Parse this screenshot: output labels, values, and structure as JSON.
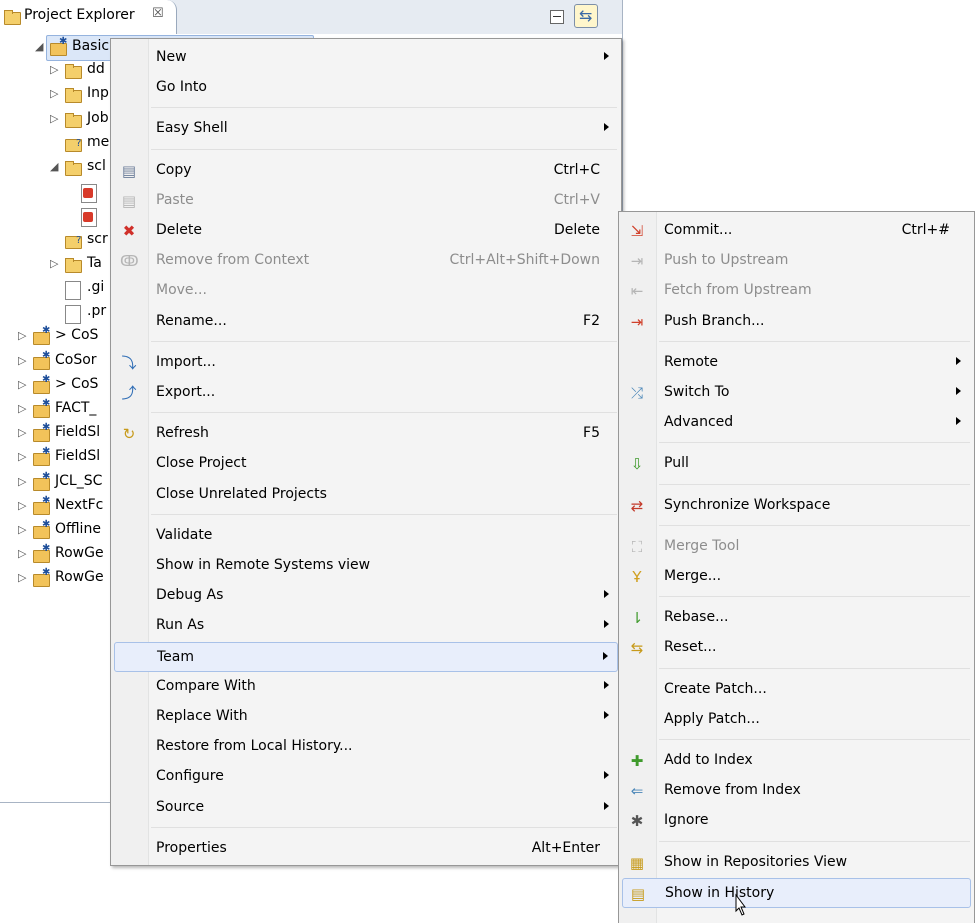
{
  "explorer": {
    "tab_title": "Project Explorer",
    "tab_close": "☒",
    "link_icon": "⇆",
    "tree": [
      {
        "label": "Basic P",
        "twisty": "◢",
        "icon": "project",
        "indent": 1,
        "selected": true
      },
      {
        "label": "dd",
        "twisty": "▷",
        "icon": "folder",
        "indent": 2
      },
      {
        "label": "Inp",
        "twisty": "▷",
        "icon": "folder",
        "indent": 2
      },
      {
        "label": "Job",
        "twisty": "▷",
        "icon": "folder",
        "indent": 2
      },
      {
        "label": "me",
        "twisty": "",
        "icon": "folder-q",
        "indent": 2
      },
      {
        "label": "scl",
        "twisty": "◢",
        "icon": "folder",
        "indent": 2
      },
      {
        "label": "",
        "twisty": "",
        "icon": "file-red",
        "indent": 3
      },
      {
        "label": "",
        "twisty": "",
        "icon": "file-red",
        "indent": 3
      },
      {
        "label": "scr",
        "twisty": "",
        "icon": "folder-q",
        "indent": 2
      },
      {
        "label": "Ta",
        "twisty": "▷",
        "icon": "folder",
        "indent": 2
      },
      {
        "label": ".gi",
        "twisty": "",
        "icon": "file",
        "indent": 2
      },
      {
        "label": ".pr",
        "twisty": "",
        "icon": "file-x",
        "indent": 2
      },
      {
        "label": "> CoS",
        "twisty": "▷",
        "icon": "project",
        "indent": 0
      },
      {
        "label": "CoSor",
        "twisty": "▷",
        "icon": "project",
        "indent": 0
      },
      {
        "label": "> CoS",
        "twisty": "▷",
        "icon": "project",
        "indent": 0
      },
      {
        "label": "FACT_",
        "twisty": "▷",
        "icon": "project",
        "indent": 0
      },
      {
        "label": "FieldSl",
        "twisty": "▷",
        "icon": "project",
        "indent": 0
      },
      {
        "label": "FieldSl",
        "twisty": "▷",
        "icon": "project",
        "indent": 0
      },
      {
        "label": "JCL_SC",
        "twisty": "▷",
        "icon": "project",
        "indent": 0
      },
      {
        "label": "NextFc",
        "twisty": "▷",
        "icon": "project",
        "indent": 0
      },
      {
        "label": "Offline",
        "twisty": "▷",
        "icon": "project",
        "indent": 0
      },
      {
        "label": "RowGe",
        "twisty": "▷",
        "icon": "project",
        "indent": 0
      },
      {
        "label": "RowGe",
        "twisty": "▷",
        "icon": "project",
        "indent": 0
      }
    ]
  },
  "context_menu": {
    "items": [
      {
        "type": "item",
        "label": "New",
        "submenu": true
      },
      {
        "type": "item",
        "label": "Go Into"
      },
      {
        "type": "sep"
      },
      {
        "type": "item",
        "label": "Easy Shell",
        "submenu": true
      },
      {
        "type": "sep"
      },
      {
        "type": "item",
        "label": "Copy",
        "shortcut": "Ctrl+C",
        "icon": "copy-icon",
        "glyph": "▤",
        "color": "#6b7d99"
      },
      {
        "type": "item",
        "label": "Paste",
        "shortcut": "Ctrl+V",
        "icon": "paste-icon",
        "glyph": "▤",
        "color": "#b5b5b5",
        "disabled": true
      },
      {
        "type": "item",
        "label": "Delete",
        "shortcut": "Delete",
        "icon": "delete-icon",
        "glyph": "✖",
        "color": "#d0302a"
      },
      {
        "type": "item",
        "label": "Remove from Context",
        "shortcut": "Ctrl+Alt+Shift+Down",
        "icon": "remove-context-icon",
        "glyph": "ↂ",
        "color": "#b5b5b5",
        "disabled": true
      },
      {
        "type": "item",
        "label": "Move...",
        "disabled": true
      },
      {
        "type": "item",
        "label": "Rename...",
        "shortcut": "F2"
      },
      {
        "type": "sep"
      },
      {
        "type": "item",
        "label": "Import...",
        "icon": "import-icon",
        "glyph": "⤵",
        "color": "#2f6db5"
      },
      {
        "type": "item",
        "label": "Export...",
        "icon": "export-icon",
        "glyph": "⤴",
        "color": "#2f6db5"
      },
      {
        "type": "sep"
      },
      {
        "type": "item",
        "label": "Refresh",
        "shortcut": "F5",
        "icon": "refresh-icon",
        "glyph": "↻",
        "color": "#c79a1a"
      },
      {
        "type": "item",
        "label": "Close Project"
      },
      {
        "type": "item",
        "label": "Close Unrelated Projects"
      },
      {
        "type": "sep"
      },
      {
        "type": "item",
        "label": "Validate"
      },
      {
        "type": "item",
        "label": "Show in Remote Systems view"
      },
      {
        "type": "item",
        "label": "Debug As",
        "submenu": true
      },
      {
        "type": "item",
        "label": "Run As",
        "submenu": true
      },
      {
        "type": "item",
        "label": "Team",
        "submenu": true,
        "highlight": true
      },
      {
        "type": "item",
        "label": "Compare With",
        "submenu": true
      },
      {
        "type": "item",
        "label": "Replace With",
        "submenu": true
      },
      {
        "type": "item",
        "label": "Restore from Local History..."
      },
      {
        "type": "item",
        "label": "Configure",
        "submenu": true
      },
      {
        "type": "item",
        "label": "Source",
        "submenu": true
      },
      {
        "type": "sep"
      },
      {
        "type": "item",
        "label": "Properties",
        "shortcut": "Alt+Enter"
      }
    ]
  },
  "team_menu": {
    "items": [
      {
        "type": "item",
        "label": "Commit...",
        "shortcut": "Ctrl+#",
        "icon": "commit-icon",
        "glyph": "⇲",
        "color": "#d0402a"
      },
      {
        "type": "item",
        "label": "Push to Upstream",
        "icon": "push-upstream-icon",
        "glyph": "⇥",
        "color": "#b5b5b5",
        "disabled": true
      },
      {
        "type": "item",
        "label": "Fetch from Upstream",
        "icon": "fetch-upstream-icon",
        "glyph": "⇤",
        "color": "#b5b5b5",
        "disabled": true
      },
      {
        "type": "item",
        "label": "Push Branch...",
        "icon": "push-branch-icon",
        "glyph": "⇥",
        "color": "#d0402a"
      },
      {
        "type": "sep"
      },
      {
        "type": "item",
        "label": "Remote",
        "submenu": true
      },
      {
        "type": "item",
        "label": "Switch To",
        "submenu": true,
        "icon": "switch-icon",
        "glyph": "⤮",
        "color": "#4a86b8"
      },
      {
        "type": "item",
        "label": "Advanced",
        "submenu": true
      },
      {
        "type": "sep"
      },
      {
        "type": "item",
        "label": "Pull",
        "icon": "pull-icon",
        "glyph": "⇩",
        "color": "#3f9a2c"
      },
      {
        "type": "sep"
      },
      {
        "type": "item",
        "label": "Synchronize Workspace",
        "icon": "synchronize-icon",
        "glyph": "⇄",
        "color": "#c33a2a"
      },
      {
        "type": "sep"
      },
      {
        "type": "item",
        "label": "Merge Tool",
        "icon": "merge-tool-icon",
        "glyph": "⛶",
        "color": "#b5b5b5",
        "disabled": true
      },
      {
        "type": "item",
        "label": "Merge...",
        "icon": "merge-icon",
        "glyph": "Ұ",
        "color": "#d0a020"
      },
      {
        "type": "sep"
      },
      {
        "type": "item",
        "label": "Rebase...",
        "icon": "rebase-icon",
        "glyph": "⇂",
        "color": "#3f9a2c"
      },
      {
        "type": "item",
        "label": "Reset...",
        "icon": "reset-icon",
        "glyph": "⇆",
        "color": "#c79a1a"
      },
      {
        "type": "sep"
      },
      {
        "type": "item",
        "label": "Create Patch..."
      },
      {
        "type": "item",
        "label": "Apply Patch..."
      },
      {
        "type": "sep"
      },
      {
        "type": "item",
        "label": "Add to Index",
        "icon": "add-index-icon",
        "glyph": "✚",
        "color": "#3f9a2c"
      },
      {
        "type": "item",
        "label": "Remove from Index",
        "icon": "remove-index-icon",
        "glyph": "⇐",
        "color": "#4a86b8"
      },
      {
        "type": "item",
        "label": "Ignore",
        "icon": "ignore-icon",
        "glyph": "✱",
        "color": "#555555"
      },
      {
        "type": "sep"
      },
      {
        "type": "item",
        "label": "Show in Repositories View",
        "icon": "repositories-icon",
        "glyph": "▦",
        "color": "#c79a1a"
      },
      {
        "type": "item",
        "label": "Show in History",
        "icon": "history-icon",
        "glyph": "▤",
        "color": "#c79a1a",
        "highlight": true
      }
    ]
  }
}
